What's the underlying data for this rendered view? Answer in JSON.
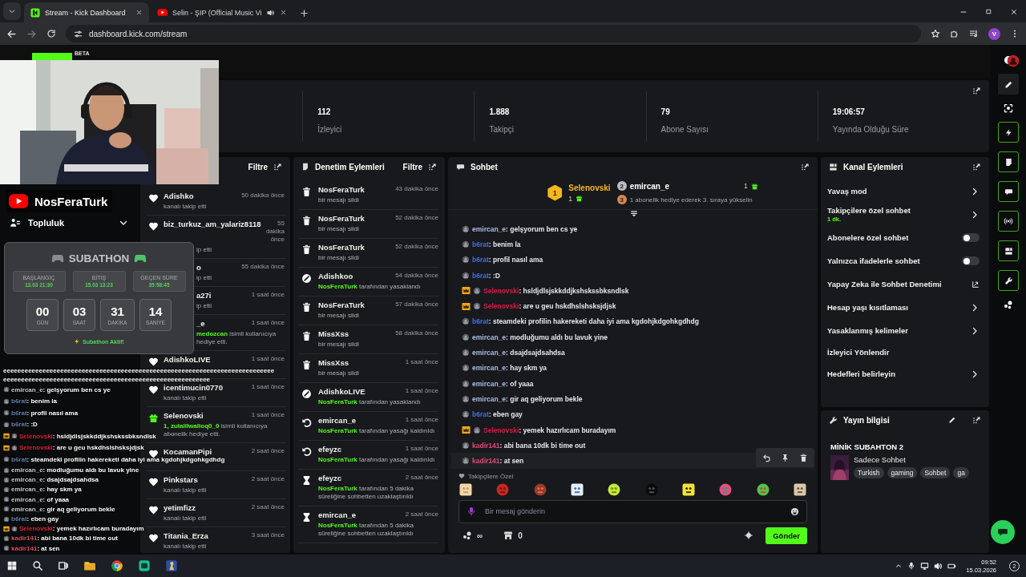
{
  "browser": {
    "tabs": [
      {
        "title": "Stream - Kick Dashboard",
        "kind": "kick",
        "selected": true,
        "audio": false
      },
      {
        "title": "Selin - ŞIP (Official Music Vi",
        "kind": "youtube",
        "selected": false,
        "audio": true
      }
    ],
    "address": "dashboard.kick.com/stream",
    "profile": "V"
  },
  "header": {
    "badge": "BETA"
  },
  "stats": [
    {
      "value": "112",
      "label": "İzleyici"
    },
    {
      "value": "1.888",
      "label": "Takipçi"
    },
    {
      "value": "79",
      "label": "Abone Sayısı"
    },
    {
      "value": "19:06:57",
      "label": "Yayında Olduğu Süre"
    }
  ],
  "activity": {
    "filter": "Filtre",
    "items": [
      {
        "kind": "follow",
        "user": "Adishko",
        "time": "50 dakika önce",
        "detail": "kanalı takip etti"
      },
      {
        "kind": "follow-cut",
        "user": "biz_turkuz_am_yalariz8118",
        "time": "55 dakika önce",
        "detail": "ip etti"
      },
      {
        "kind": "partial",
        "user": "o",
        "time": "55 dakika önce",
        "detail": "ip etti"
      },
      {
        "kind": "partial",
        "user": "a27i",
        "time": "1 saat önce",
        "detail": "ip etti"
      },
      {
        "kind": "partial",
        "user": "_e",
        "time": "1 saat önce",
        "highlight": "medozcan",
        "detail": "isimli kullanıcıya hediye etti."
      },
      {
        "kind": "follow",
        "user": "AdishkoLIVE",
        "time": "1 saat önce"
      },
      {
        "kind": "follow",
        "user": "icentimucin0770",
        "time": "1 saat önce",
        "detail": "kanalı takip etti"
      },
      {
        "kind": "gift",
        "user": "Selenovski",
        "time": "1 saat önce",
        "highlight": "1, zulalllwalloq0_0",
        "detail": "isimli kullanıcıya abonelik hediye etti."
      },
      {
        "kind": "follow",
        "user": "KocamanPipi",
        "time": "2 saat önce"
      },
      {
        "kind": "follow",
        "user": "Pinkstars",
        "time": "2 saat önce",
        "detail": "kanalı takip etti"
      },
      {
        "kind": "follow",
        "user": "yetimfizz",
        "time": "2 saat önce",
        "detail": "kanalı takip etti"
      },
      {
        "kind": "follow",
        "user": "Titania_Erza",
        "time": "3 saat önce",
        "detail": "kanalı takip etti"
      }
    ]
  },
  "moderation": {
    "title": "Denetim Eylemleri",
    "filter": "Filtre",
    "items": [
      {
        "kind": "delete",
        "user": "NosFeraTurk",
        "time": "43 dakika önce",
        "detail": "bir mesajı sildi"
      },
      {
        "kind": "delete",
        "user": "NosFeraTurk",
        "time": "52 dakika önce",
        "detail": "bir mesajı sildi"
      },
      {
        "kind": "delete",
        "user": "NosFeraTurk",
        "time": "52 dakika önce",
        "detail": "bir mesajı sildi"
      },
      {
        "kind": "ban",
        "user": "Adishkoo",
        "time": "54 dakika önce",
        "actor": "NosFeraTurk",
        "detail": "tarafından yasaklandı"
      },
      {
        "kind": "delete",
        "user": "NosFeraTurk",
        "time": "57 dakika önce",
        "detail": "bir mesajı sildi"
      },
      {
        "kind": "delete",
        "user": "MissXss",
        "time": "58 dakika önce",
        "detail": "bir mesajı sildi"
      },
      {
        "kind": "delete",
        "user": "MissXss",
        "time": "1 saat önce",
        "detail": "bir mesajı sildi"
      },
      {
        "kind": "ban",
        "user": "AdishkoLIVE",
        "time": "1 saat önce",
        "actor": "NosFeraTurk",
        "detail": "tarafından yasaklandı"
      },
      {
        "kind": "unban",
        "user": "emircan_e",
        "time": "1 saat önce",
        "actor": "NosFeraTurk",
        "detail": "tarafından yasağı kaldırıldı"
      },
      {
        "kind": "unban",
        "user": "efeyzc",
        "time": "1 saat önce",
        "actor": "NosFeraTurk",
        "detail": "tarafından yasağı kaldırıldı"
      },
      {
        "kind": "timeout",
        "user": "efeyzc",
        "time": "2 saat önce",
        "actor": "NosFeraTurk",
        "detail": "tarafından 5 dakika süreliğine sohbetten uzaklaştırıldı"
      },
      {
        "kind": "timeout",
        "user": "emircan_e",
        "time": "2 saat önce",
        "actor": "NosFeraTurk",
        "detail": "tarafından 5 dakika süreliğine sohbetten uzaklaştırıldı"
      }
    ]
  },
  "chat": {
    "title": "Sohbet",
    "leaderboard": [
      {
        "rank": "1",
        "name": "Selenovski",
        "count": "1",
        "color": "#f5b81c"
      },
      {
        "rank": "2",
        "name": "emircan_e",
        "count": "1",
        "color": "#b9bbc2"
      }
    ],
    "next_rank": {
      "rank": "3",
      "text": "1 abonelik hediye ederek 3. sıraya yükselin",
      "color": "#d8874a"
    },
    "messages": [
      {
        "user": "emircan_e",
        "text": ": gelşyorum ben cs ye",
        "color": "#a9bde6",
        "crown": false,
        "hovered": false
      },
      {
        "user": "b6rat",
        "text": ": benim la",
        "color": "#3d72e6",
        "crown": false,
        "hovered": false
      },
      {
        "user": "b6rat",
        "text": ": profil nasıl ama",
        "color": "#3d72e6",
        "crown": false,
        "hovered": false
      },
      {
        "user": "b6rat",
        "text": ": :D",
        "color": "#3d72e6",
        "crown": false,
        "hovered": false
      },
      {
        "user": "Selenovski",
        "text": ": hsldjdlsjskkddjkshskssbksndlsk",
        "color": "#d91a4c",
        "crown": true,
        "hovered": false
      },
      {
        "user": "Selenovski",
        "text": ": are u geu hskdhslshsksjdjsk",
        "color": "#d91a4c",
        "crown": true,
        "hovered": false
      },
      {
        "user": "b6rat",
        "text": ": steamdeki profilin hakereketi daha iyi ama kgdohjkdgohkgdhdg",
        "color": "#3d72e6",
        "crown": false,
        "hovered": false
      },
      {
        "user": "emircan_e",
        "text": ": modluğumu aldı bu lavuk yine",
        "color": "#a9bde6",
        "crown": false,
        "hovered": false
      },
      {
        "user": "emircan_e",
        "text": ": dsajdsajdsahdsa",
        "color": "#a9bde6",
        "crown": false,
        "hovered": false
      },
      {
        "user": "emircan_e",
        "text": ": hay skm ya",
        "color": "#a9bde6",
        "crown": false,
        "hovered": false
      },
      {
        "user": "emircan_e",
        "text": ": of yaaa",
        "color": "#a9bde6",
        "crown": false,
        "hovered": false
      },
      {
        "user": "emircan_e",
        "text": ": gir aq geliyorum bekle",
        "color": "#a9bde6",
        "crown": false,
        "hovered": false
      },
      {
        "user": "b6rat",
        "text": ": eben gay",
        "color": "#3d72e6",
        "crown": false,
        "hovered": false
      },
      {
        "user": "Selenovski",
        "text": ": yemek hazırlıcam buradayım",
        "color": "#d91a4c",
        "crown": true,
        "hovered": false
      },
      {
        "user": "kadir141",
        "text": ": abi bana 10dk bi time out",
        "color": "#e04a78",
        "crown": false,
        "hovered": false
      },
      {
        "user": "kadir141",
        "text": ": at sen",
        "color": "#e04a78",
        "crown": false,
        "hovered": true
      }
    ],
    "emote_section": "Takipçilere Özel",
    "input": {
      "placeholder": "Bir mesaj gönderin"
    },
    "points": "∞",
    "store_count": "0",
    "send": "Gönder"
  },
  "channel_actions": {
    "title": "Kanal Eylemleri",
    "items": [
      {
        "label": "Yavaş mod",
        "kind": "arrow"
      },
      {
        "label": "Takipçilere özel sohbet",
        "value": "1 dk.",
        "kind": "arrow"
      },
      {
        "label": "Abonelere özel sohbet",
        "kind": "toggle",
        "on": false
      },
      {
        "label": "Yalnızca ifadelerle sohbet",
        "kind": "toggle",
        "on": false
      },
      {
        "label": "Yapay Zeka ile Sohbet Denetimi",
        "kind": "external"
      },
      {
        "label": "Hesap yaşı kısıtlaması",
        "kind": "arrow"
      },
      {
        "label": "Yasaklanmış kelimeler",
        "kind": "arrow"
      },
      {
        "label": "İzleyici Yönlendir",
        "kind": "plain"
      },
      {
        "label": "Hedefleri belirleyin",
        "kind": "arrow"
      }
    ]
  },
  "stream_info": {
    "title": "Yayın bilgisi",
    "stream_title": "MİNİK SUBAHTON 2",
    "category": "Sadece Sohbet",
    "tags": [
      "Turkish",
      "gaming",
      "Sohbet",
      "ga"
    ]
  },
  "overlay": {
    "channel": "NosFeraTurk",
    "community": "Topluluk",
    "subathon": {
      "title": "SUBATHON",
      "info": [
        {
          "label": "BAŞLANGIÇ",
          "value": "13.03 21:30"
        },
        {
          "label": "BİTİŞ",
          "value": "15.03 13:23"
        },
        {
          "label": "GEÇEN SÜRE",
          "value": "35:58:45"
        }
      ],
      "countdown": [
        {
          "value": "00",
          "unit": "GÜN"
        },
        {
          "value": "03",
          "unit": "SAAT"
        },
        {
          "value": "31",
          "unit": "DAKİKA"
        },
        {
          "value": "14",
          "unit": "SANİYE"
        }
      ],
      "status": "Subathon Aktif!"
    },
    "chat": [
      {
        "text": "eeeeeeeeeeeeeeeeeeeeeeeeeeeeeeeeeeeeeeeeeeeeeeeeeeeeeeeeeeeeeeeeeeeeeeeeeeeeeeeeeeeeeeeeeeeeeeeeeeeeeeeeeeeeeeeeeeeeeeeeeeeeeeeeeeeeee"
      },
      {
        "user": "emircan_e",
        "text": ": gelşyorum ben cs ye",
        "color": "#c9c9d2",
        "crown": false
      },
      {
        "user": "b6rat",
        "text": ": benim la",
        "color": "#5d82b0",
        "crown": false
      },
      {
        "user": "b6rat",
        "text": ": profil nasıl ama",
        "color": "#5d82b0",
        "crown": false
      },
      {
        "user": "b6rat",
        "text": ": :D",
        "color": "#5d82b0",
        "crown": false
      },
      {
        "user": "Selenovski",
        "text": ": hsldjdlsjskkddjkshskssbksndlsk",
        "color": "#e0203a",
        "crown": true
      },
      {
        "user": "Selenovski",
        "text": ": are u geu hskdhslshsksjdjsk",
        "color": "#e0203a",
        "crown": true
      },
      {
        "user": "b6rat",
        "text": ": steamdeki profilin hakereketi daha iyi ama kgdohjkdgohkgdhdg",
        "color": "#5d82b0",
        "crown": false
      },
      {
        "user": "emircan_e",
        "text": ": modluğumu aldı bu lavuk yine",
        "color": "#c9c9d2",
        "crown": false
      },
      {
        "user": "emircan_e",
        "text": ": dsajdsajdsahdsa",
        "color": "#c9c9d2",
        "crown": false
      },
      {
        "user": "emircan_e",
        "text": ": hay skm ya",
        "color": "#c9c9d2",
        "crown": false
      },
      {
        "user": "emircan_e",
        "text": ": of yaaa",
        "color": "#c9c9d2",
        "crown": false
      },
      {
        "user": "emircan_e",
        "text": ": gir aq geliyorum bekle",
        "color": "#c9c9d2",
        "crown": false
      },
      {
        "user": "b6rat",
        "text": ": eben gay",
        "color": "#5d82b0",
        "crown": false
      },
      {
        "user": "Selenovski",
        "text": ": yemek hazırlıcam buradayım",
        "color": "#e0203a",
        "crown": true
      },
      {
        "user": "kadir141",
        "text": ": abi bana 10dk bi time out",
        "color": "#e04a6a",
        "crown": false
      },
      {
        "user": "kadir141",
        "text": ": at sen",
        "color": "#e04a6a",
        "crown": false
      }
    ]
  },
  "taskbar": {
    "time": "09:52",
    "date": "15.03.2026",
    "notifications": "2"
  }
}
